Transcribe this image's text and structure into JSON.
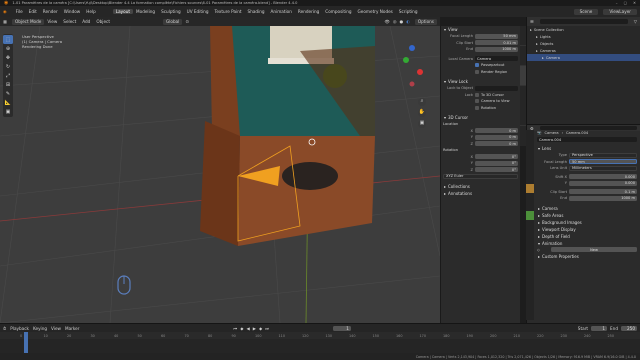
{
  "titlebar": {
    "text": "1-01 Paramètres de la caméra [C:\\Users\\Yuji\\Desktop\\Blender 4.4 La formation complète\\Fichiers sources\\6-01 Paramètres de la caméra.blend] - Blender 4.4.0"
  },
  "menus": [
    "File",
    "Edit",
    "Render",
    "Window",
    "Help"
  ],
  "workspaces": [
    "Layout",
    "Modeling",
    "Sculpting",
    "UV Editing",
    "Texture Paint",
    "Shading",
    "Animation",
    "Rendering",
    "Compositing",
    "Geometry Nodes",
    "Scripting"
  ],
  "active_workspace": "Layout",
  "scene": {
    "label": "Scene",
    "view_layer": "ViewLayer"
  },
  "viewport": {
    "mode": "Object Mode",
    "menus": [
      "View",
      "Select",
      "Add",
      "Object"
    ],
    "transform": "Global",
    "options": "Options",
    "overlay_lines": [
      "User Perspective",
      "(1) Camera | Camera",
      "Rendering Done"
    ]
  },
  "npanel": {
    "tabs": [
      "Item",
      "Tool",
      "View",
      "Screencast Keys"
    ],
    "view_title": "View",
    "focal_label": "Focal Length",
    "focal_value": "50 mm",
    "clip_label": "Clip Start",
    "clip_start": "0.01 m",
    "end_label": "End",
    "clip_end": "1000 m",
    "local_camera_label": "Local Camera",
    "local_camera": "Camera",
    "passepartout": "Passepartout",
    "render_region": "Render Region",
    "viewlock_title": "View Lock",
    "lock_object_label": "Lock to Object",
    "lock_label": "Lock",
    "to_cursor": "To 3D Cursor",
    "camera_to_view": "Camera to View",
    "rotation": "Rotation",
    "cursor_title": "3D Cursor",
    "location_label": "Location",
    "loc": [
      {
        "axis": "X",
        "val": "0 m"
      },
      {
        "axis": "Y",
        "val": "0 m"
      },
      {
        "axis": "Z",
        "val": "0 m"
      }
    ],
    "rotation_label": "Rotation",
    "rot": [
      {
        "axis": "X",
        "val": "0°"
      },
      {
        "axis": "Y",
        "val": "0°"
      },
      {
        "axis": "Z",
        "val": "0°"
      }
    ],
    "rot_mode": "XYZ Euler",
    "collections": "Collections",
    "annotations": "Annotations"
  },
  "outliner": {
    "title": "Scene Collection",
    "items": [
      {
        "name": "Scene Collection",
        "indent": 0,
        "sel": false
      },
      {
        "name": "Lights",
        "indent": 1,
        "sel": false
      },
      {
        "name": "Objects",
        "indent": 1,
        "sel": false
      },
      {
        "name": "Cameras",
        "indent": 1,
        "sel": false
      },
      {
        "name": "Camera",
        "indent": 2,
        "sel": true
      }
    ]
  },
  "properties": {
    "crumb1": "Camera",
    "crumb2": "Camera.004",
    "data_name": "Camera.004",
    "lens_title": "Lens",
    "type_label": "Type",
    "type_value": "Perspective",
    "focal_label": "Focal Length",
    "focal_value": "50 mm",
    "units_label": "Lens Unit",
    "units_value": "Millimeters",
    "shiftx_label": "Shift X",
    "shiftx": "0.000",
    "y_label": "Y",
    "shifty": "0.000",
    "clip_start_label": "Clip Start",
    "clip_start": "0.1 m",
    "end_label": "End",
    "clip_end": "1000 m",
    "sections": [
      "Camera",
      "Safe Areas",
      "Background Images",
      "Viewport Display",
      "Depth of Field"
    ],
    "animation_title": "Animation",
    "anim_button": "New",
    "custom": "Custom Properties"
  },
  "timeline": {
    "menus": [
      "Playback",
      "Keying",
      "View",
      "Marker"
    ],
    "current_frame": "1",
    "start_label": "Start",
    "start": "1",
    "end_label": "End",
    "end": "250",
    "ticks": [
      "0",
      "10",
      "20",
      "30",
      "40",
      "50",
      "60",
      "70",
      "80",
      "90",
      "100",
      "110",
      "120",
      "130",
      "140",
      "150",
      "160",
      "170",
      "180",
      "190",
      "200",
      "210",
      "220",
      "230",
      "240",
      "250"
    ]
  },
  "status": {
    "text": "Camera | Camera | Verts 2,143,904 | Faces 1,012,320 | Tris 2,071,426 | Objects 1/26 | Memory: 916.9 MiB | VRAM 6.9/16.0 GiB | 4.4.0"
  },
  "colors": {
    "accent": "#4772b3",
    "selected": "#334d80",
    "wall": "#1e5b57",
    "floor": "#8a4a28",
    "camera": "#f0a020"
  }
}
